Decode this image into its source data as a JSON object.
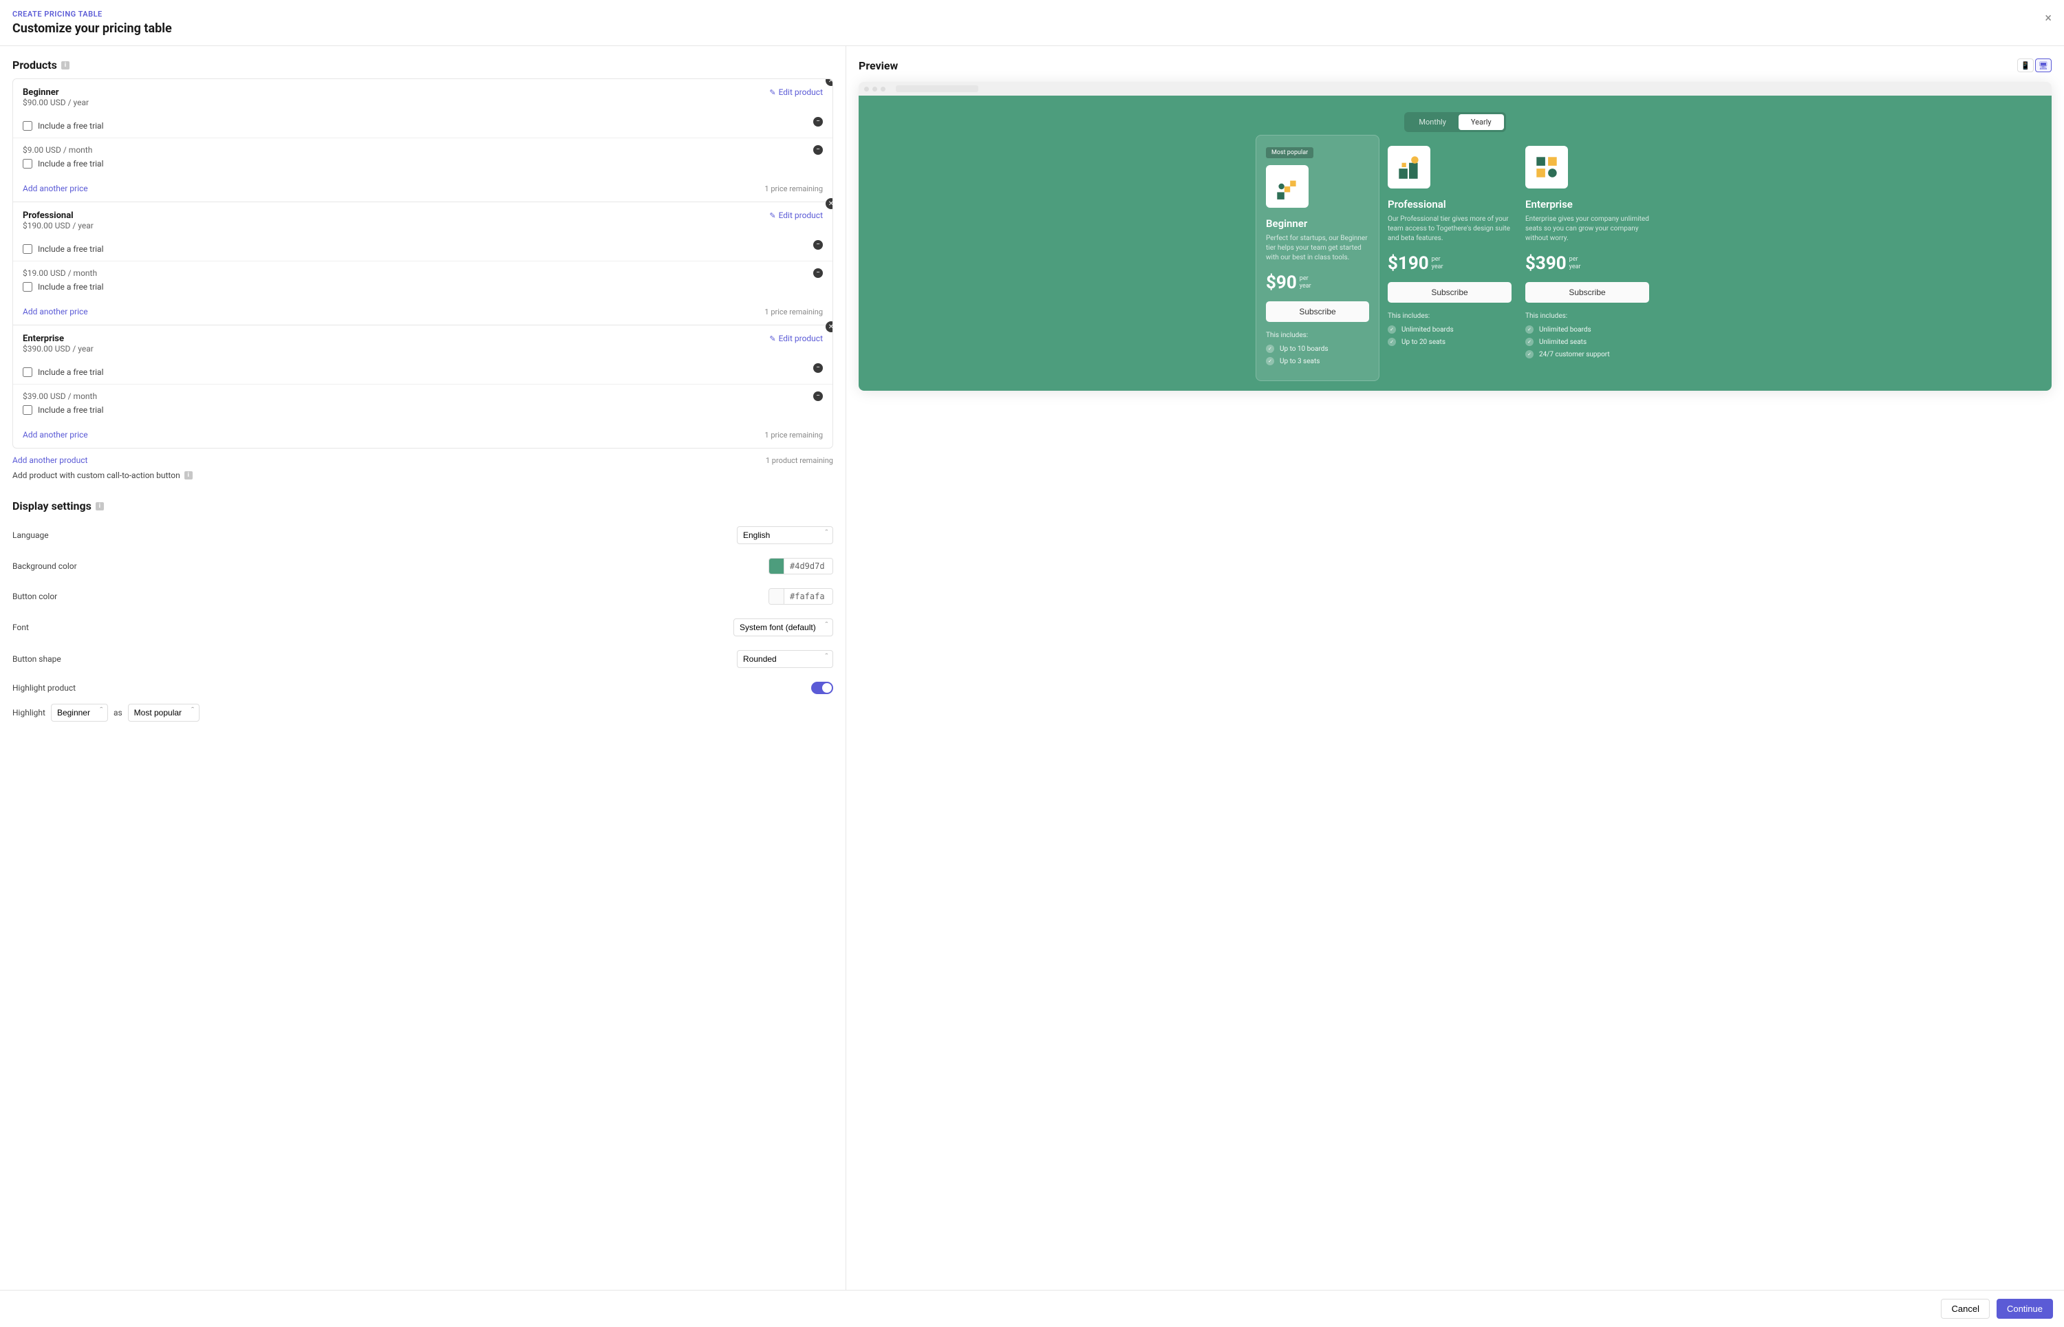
{
  "header": {
    "breadcrumb": "CREATE PRICING TABLE",
    "title": "Customize your pricing table"
  },
  "products_section": {
    "title": "Products",
    "add_another_product": "Add another product",
    "product_remaining": "1 product remaining",
    "custom_cta": "Add product with custom call-to-action button",
    "edit_label": "Edit product",
    "add_another_price": "Add another price",
    "price_remaining": "1 price remaining",
    "free_trial_label": "Include a free trial",
    "items": [
      {
        "name": "Beginner",
        "prices": [
          {
            "display": "$90.00 USD / year"
          },
          {
            "display": "$9.00 USD / month"
          }
        ]
      },
      {
        "name": "Professional",
        "prices": [
          {
            "display": "$190.00 USD / year"
          },
          {
            "display": "$19.00 USD / month"
          }
        ]
      },
      {
        "name": "Enterprise",
        "prices": [
          {
            "display": "$390.00 USD / year"
          },
          {
            "display": "$39.00 USD / month"
          }
        ]
      }
    ]
  },
  "display_settings": {
    "title": "Display settings",
    "language_label": "Language",
    "language_value": "English",
    "bg_label": "Background color",
    "bg_value": "#4d9d7d",
    "btn_label": "Button color",
    "btn_value": "#fafafa",
    "font_label": "Font",
    "font_value": "System font (default)",
    "shape_label": "Button shape",
    "shape_value": "Rounded",
    "highlight_label": "Highlight product",
    "highlight_row_prefix": "Highlight",
    "highlight_product": "Beginner",
    "highlight_as": "as",
    "highlight_badge": "Most popular"
  },
  "footer": {
    "cancel": "Cancel",
    "continue": "Continue"
  },
  "preview": {
    "title": "Preview",
    "monthly": "Monthly",
    "yearly": "Yearly",
    "subscribe": "Subscribe",
    "includes": "This includes:",
    "badge": "Most popular",
    "plans": [
      {
        "name": "Beginner",
        "desc": "Perfect for startups, our Beginner tier helps your team get started with our best in class tools.",
        "price": "$90",
        "per": "per\nyear",
        "features": [
          "Up to 10 boards",
          "Up to 3 seats"
        ],
        "highlighted": true
      },
      {
        "name": "Professional",
        "desc": "Our Professional tier gives more of your team access to Togethere's design suite and beta features.",
        "price": "$190",
        "per": "per\nyear",
        "features": [
          "Unlimited boards",
          "Up to 20 seats"
        ],
        "highlighted": false
      },
      {
        "name": "Enterprise",
        "desc": "Enterprise gives your company unlimited seats so you can grow your company without worry.",
        "price": "$390",
        "per": "per\nyear",
        "features": [
          "Unlimited boards",
          "Unlimited seats",
          "24/7 customer support"
        ],
        "highlighted": false
      }
    ]
  }
}
